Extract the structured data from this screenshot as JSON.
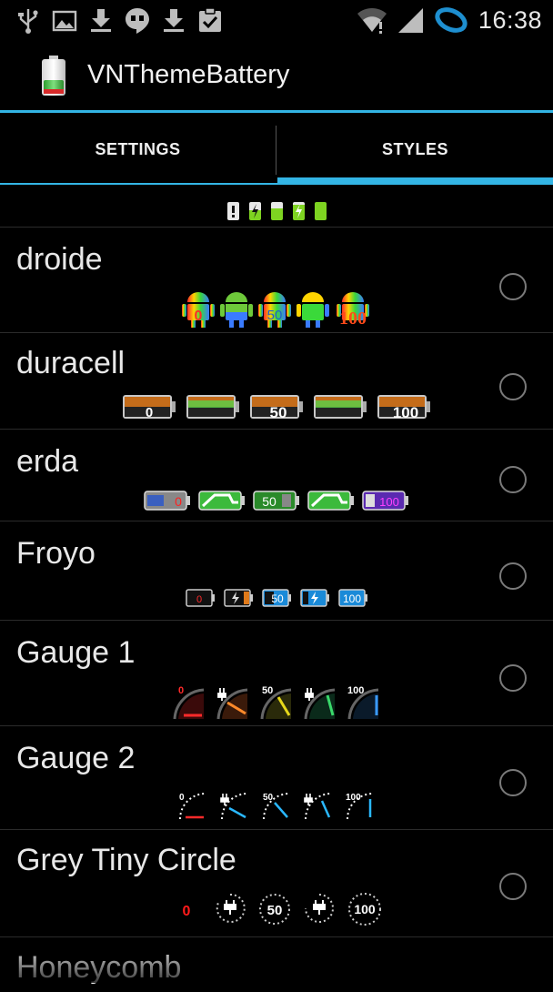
{
  "status_bar": {
    "time": "16:38",
    "left_icons": [
      "usb-icon",
      "image-icon",
      "download-icon",
      "hangouts-icon",
      "download-icon",
      "clipboard-check-icon"
    ],
    "right_icons": [
      "wifi-icon",
      "signal-icon",
      "sync-ring-icon"
    ]
  },
  "app": {
    "title": "VNThemeBattery",
    "icon": "battery-app-icon"
  },
  "tabs": [
    {
      "label": "SETTINGS",
      "selected": false
    },
    {
      "label": "STYLES",
      "selected": true
    }
  ],
  "accent_color": "#33b5e5",
  "styles": [
    {
      "name": "droide",
      "levels": [
        "0",
        "",
        "50",
        "",
        "100"
      ],
      "selected": false
    },
    {
      "name": "duracell",
      "levels": [
        "0",
        "",
        "50",
        "",
        "100"
      ],
      "selected": false
    },
    {
      "name": "erda",
      "levels": [
        "0",
        "",
        "50",
        "",
        "100"
      ],
      "selected": false
    },
    {
      "name": "Froyo",
      "levels": [
        "0",
        "",
        "50",
        "",
        "100"
      ],
      "selected": false
    },
    {
      "name": "Gauge 1",
      "levels": [
        "0",
        "",
        "50",
        "",
        "100"
      ],
      "selected": false
    },
    {
      "name": "Gauge 2",
      "levels": [
        "0",
        "",
        "50",
        "",
        "100"
      ],
      "selected": false
    },
    {
      "name": "Grey Tiny Circle",
      "levels": [
        "0",
        "",
        "50",
        "",
        "100"
      ],
      "selected": false
    },
    {
      "name": "Honeycomb",
      "levels": [],
      "selected": false
    }
  ]
}
